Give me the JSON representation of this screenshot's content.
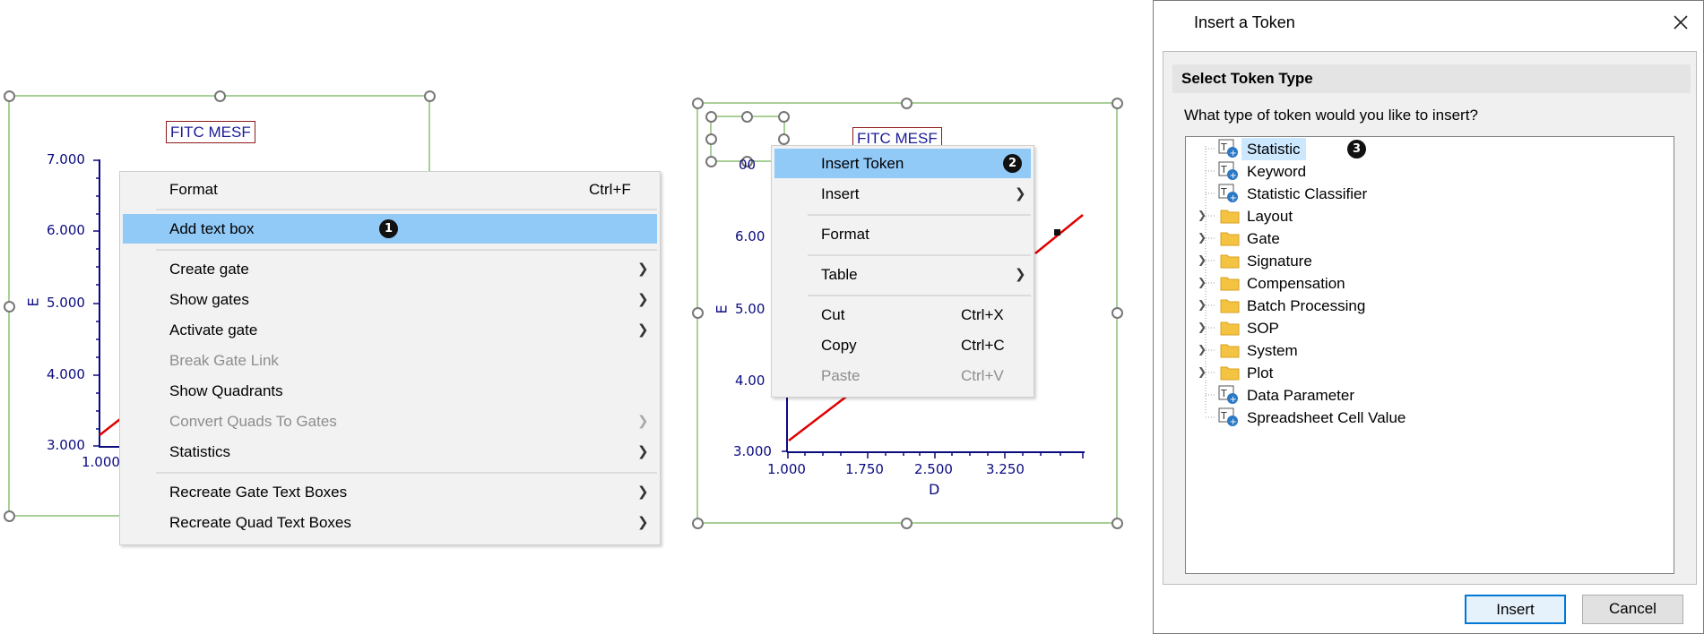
{
  "left_panel": {
    "title": "FITC MESF",
    "y_axis_label": "E",
    "y_ticks": [
      "7.000",
      "6.000",
      "5.000",
      "4.000",
      "3.000"
    ],
    "x_ticks": [
      "1.000"
    ]
  },
  "menu1": {
    "items": [
      {
        "label": "Format",
        "shortcut": "Ctrl+F"
      },
      {
        "label": "Add text box",
        "badge": "1"
      },
      {
        "label": "Create gate"
      },
      {
        "label": "Show gates"
      },
      {
        "label": "Activate gate"
      },
      {
        "label": "Break Gate Link"
      },
      {
        "label": "Show Quadrants"
      },
      {
        "label": "Convert Quads To Gates"
      },
      {
        "label": "Statistics"
      },
      {
        "label": "Recreate Gate Text Boxes"
      },
      {
        "label": "Recreate Quad Text Boxes"
      }
    ]
  },
  "middle_panel": {
    "title": "FITC MESF",
    "y_axis_label": "E",
    "x_axis_label": "D",
    "y_ticks": [
      "6.00",
      "5.00",
      "4.00",
      "3.000"
    ],
    "y_tick_top_fragment": "00",
    "x_ticks": [
      "1.000",
      "1.750",
      "2.500",
      "3.250"
    ]
  },
  "menu2": {
    "items": [
      {
        "label": "Insert Token",
        "badge": "2"
      },
      {
        "label": "Insert"
      },
      {
        "label": "Format"
      },
      {
        "label": "Table"
      },
      {
        "label": "Cut",
        "shortcut": "Ctrl+X"
      },
      {
        "label": "Copy",
        "shortcut": "Ctrl+C"
      },
      {
        "label": "Paste",
        "shortcut": "Ctrl+V"
      }
    ]
  },
  "dialog": {
    "title": "Insert a Token",
    "section": "Select Token Type",
    "question": "What type of token would you like to insert?",
    "tree": [
      {
        "label": "Statistic",
        "badge": "3",
        "icon": "token-icon"
      },
      {
        "label": "Keyword",
        "icon": "token-icon"
      },
      {
        "label": "Statistic Classifier",
        "icon": "token-icon"
      },
      {
        "label": "Layout",
        "icon": "folder-icon"
      },
      {
        "label": "Gate",
        "icon": "folder-icon"
      },
      {
        "label": "Signature",
        "icon": "folder-icon"
      },
      {
        "label": "Compensation",
        "icon": "folder-icon"
      },
      {
        "label": "Batch Processing",
        "icon": "folder-icon"
      },
      {
        "label": "SOP",
        "icon": "folder-icon"
      },
      {
        "label": "System",
        "icon": "folder-icon"
      },
      {
        "label": "Plot",
        "icon": "folder-icon"
      },
      {
        "label": "Data Parameter",
        "icon": "token-icon"
      },
      {
        "label": "Spreadsheet Cell Value",
        "icon": "token-icon"
      }
    ],
    "insert_button": "Insert",
    "cancel_button": "Cancel"
  },
  "colors": {
    "highlight": "#91c9f7",
    "selection_frame": "#a9cf98",
    "axis_text": "#0b0b80",
    "data_line": "#e00000",
    "primary_button_border": "#0078d7"
  }
}
